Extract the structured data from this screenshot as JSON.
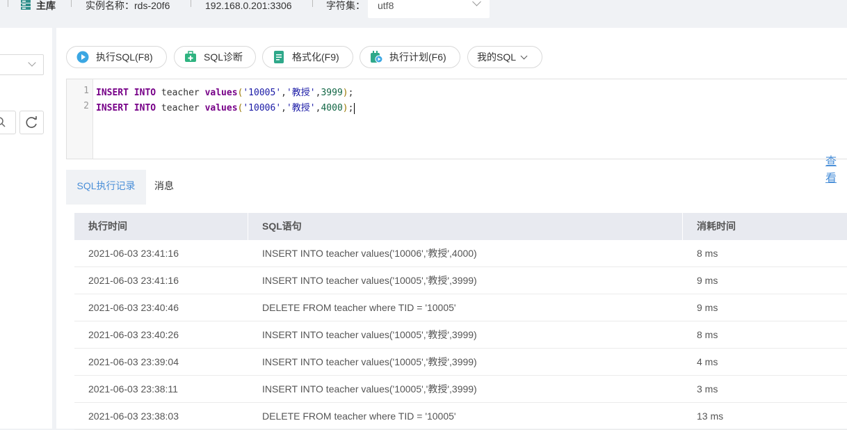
{
  "topbar": {
    "instance_role": "主库",
    "instance_name": "实例名称：rds-20f6",
    "address": "192.168.0.201:3306",
    "charset_label": "字符集：",
    "charset_value": "utf8"
  },
  "toolbar": {
    "execute_label": "执行SQL(F8)",
    "diagnose_label": "SQL诊断",
    "format_label": "格式化(F9)",
    "plan_label": "执行计划(F6)",
    "my_sql_label": "我的SQL"
  },
  "editor": {
    "line_numbers": [
      "1",
      "2"
    ]
  },
  "tabs": {
    "history": "SQL执行记录",
    "messages": "消息",
    "view_all": "查看"
  },
  "table": {
    "columns": [
      "执行时间",
      "SQL语句",
      "消耗时间"
    ],
    "rows": [
      [
        "2021-06-03 23:41:16",
        "INSERT INTO teacher values('10006','教授',4000)",
        "8 ms"
      ],
      [
        "2021-06-03 23:41:16",
        "INSERT INTO teacher values('10005','教授',3999)",
        "9 ms"
      ],
      [
        "2021-06-03 23:40:46",
        "DELETE FROM teacher where TID = '10005'",
        "9 ms"
      ],
      [
        "2021-06-03 23:40:26",
        "INSERT INTO teacher values('10005','教授',3999)",
        "8 ms"
      ],
      [
        "2021-06-03 23:39:04",
        "INSERT INTO teacher values('10005','教授',3999)",
        "4 ms"
      ],
      [
        "2021-06-03 23:38:11",
        "INSERT INTO teacher values('10005','教授',3999)",
        "3 ms"
      ],
      [
        "2021-06-03 23:38:03",
        "DELETE FROM teacher where TID = '10005'",
        "13 ms"
      ]
    ]
  }
}
